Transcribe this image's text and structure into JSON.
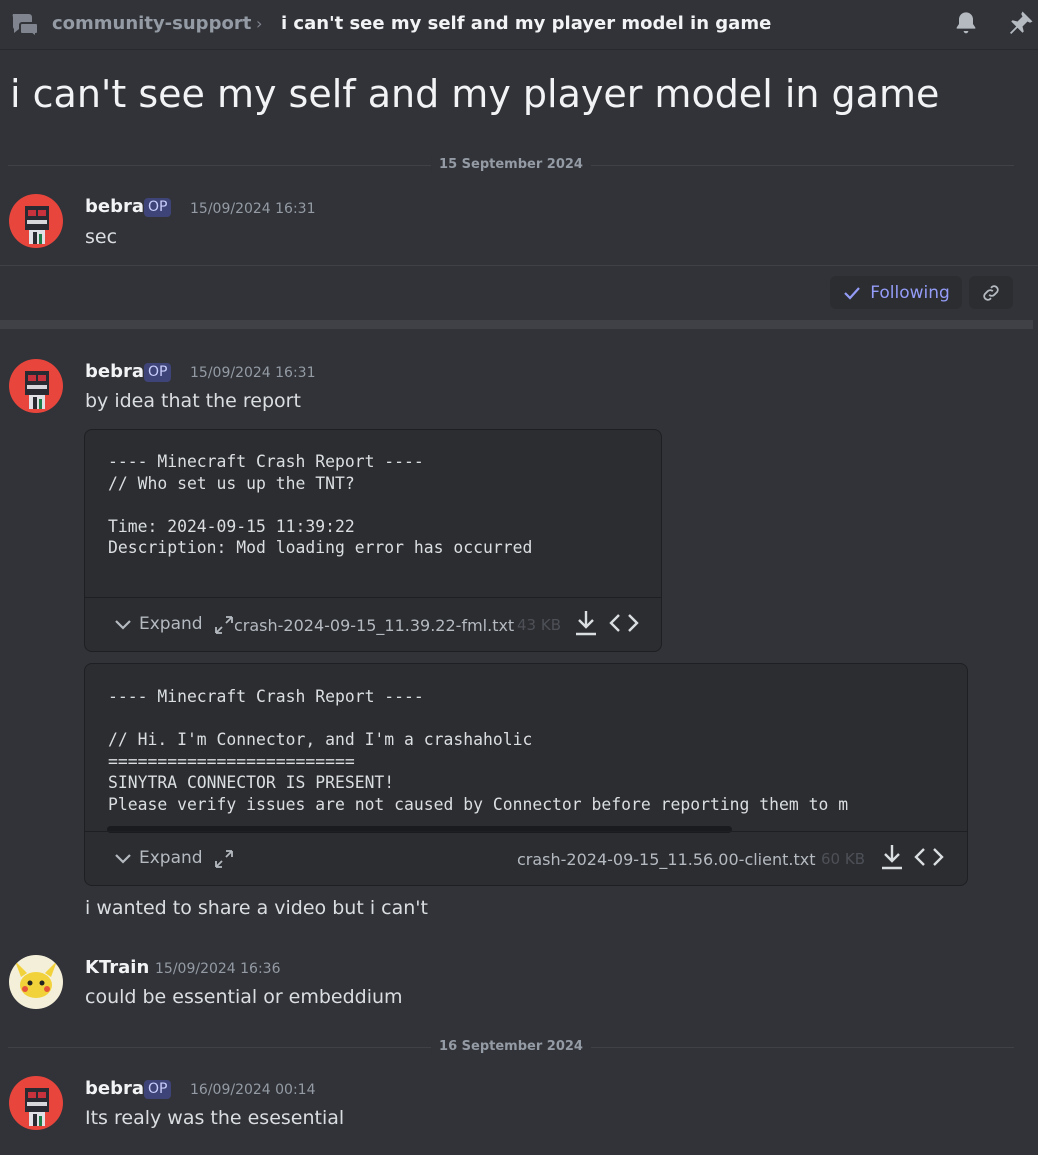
{
  "header": {
    "channel": "community-support",
    "separator": "›",
    "thread_title": "i can't see my self and my player model in game"
  },
  "title": "i can't see my self and my player model in game",
  "dates": [
    "15 September 2024",
    "16 September 2024"
  ],
  "thread_actions": {
    "follow_label": "Following"
  },
  "messages": [
    {
      "author": "bebra",
      "op": "OP",
      "timestamp": "15/09/2024 16:31",
      "text": "sec"
    },
    {
      "author": "bebra",
      "op": "OP",
      "timestamp": "15/09/2024 16:31",
      "text": "by idea that the report",
      "text2": "i wanted to share a video but i can't",
      "attachments": [
        {
          "code": "---- Minecraft Crash Report ----\n// Who set us up the TNT?\n\nTime: 2024-09-15 11:39:22\nDescription: Mod loading error has occurred",
          "expand_label": "Expand",
          "filename": "crash-2024-09-15_11.39.22-fml.txt",
          "size": "43 KB"
        },
        {
          "code": "---- Minecraft Crash Report ----\n\n// Hi. I'm Connector, and I'm a crashaholic\n=========================\nSINYTRA CONNECTOR IS PRESENT!\nPlease verify issues are not caused by Connector before reporting them to m",
          "expand_label": "Expand",
          "filename": "crash-2024-09-15_11.56.00-client.txt",
          "size": "60 KB"
        }
      ]
    },
    {
      "author": "KTrain",
      "timestamp": "15/09/2024 16:36",
      "text": "could be essential or embeddium"
    },
    {
      "author": "bebra",
      "op": "OP",
      "timestamp": "16/09/2024 00:14",
      "text": "Its realy was the esesential"
    }
  ],
  "colors": {
    "bg": "#313338",
    "op_badge": "#5865f2",
    "follow": "#949cf7"
  }
}
